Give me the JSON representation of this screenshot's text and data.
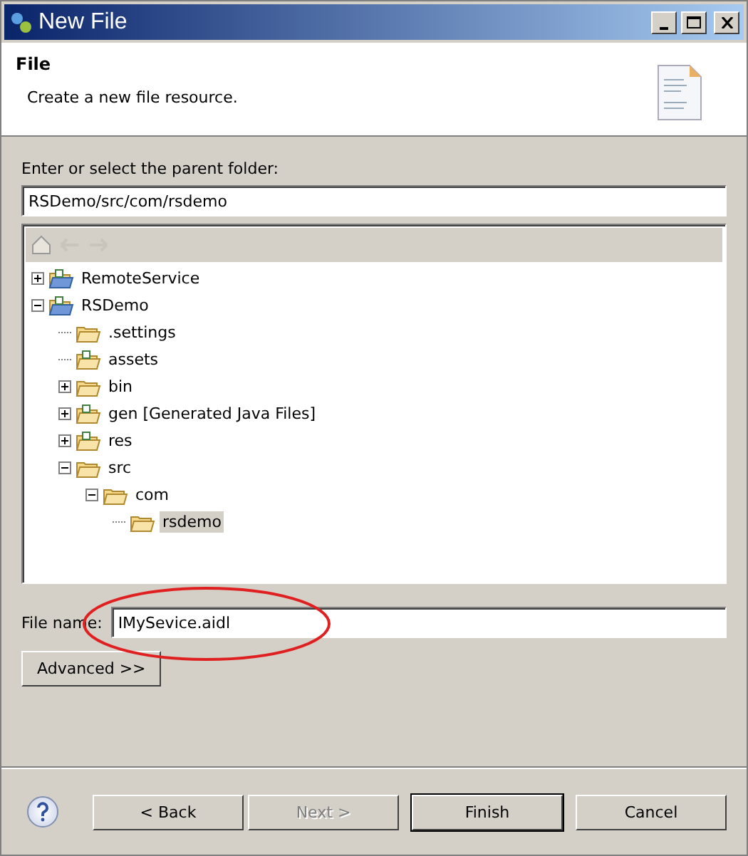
{
  "window": {
    "title": "New File"
  },
  "header": {
    "title": "File",
    "description": "Create a new file resource."
  },
  "folder_label": "Enter or select the parent folder:",
  "folder_path": "RSDemo/src/com/rsdemo",
  "tree": [
    {
      "label": "RemoteService",
      "kind": "project",
      "expanded": false,
      "selected": false
    },
    {
      "label": "RSDemo",
      "kind": "project",
      "expanded": true,
      "selected": false,
      "children": [
        {
          "label": ".settings",
          "kind": "folder",
          "selected": false
        },
        {
          "label": "assets",
          "kind": "source",
          "selected": false
        },
        {
          "label": "bin",
          "kind": "folder",
          "expanded": false,
          "selected": false
        },
        {
          "label": "gen [Generated Java Files]",
          "kind": "source",
          "expanded": false,
          "selected": false
        },
        {
          "label": "res",
          "kind": "source",
          "expanded": false,
          "selected": false
        },
        {
          "label": "src",
          "kind": "folder",
          "expanded": true,
          "selected": false,
          "children": [
            {
              "label": "com",
              "kind": "folder",
              "expanded": true,
              "selected": false,
              "children": [
                {
                  "label": "rsdemo",
                  "kind": "folder",
                  "selected": true
                }
              ]
            }
          ]
        }
      ]
    }
  ],
  "file_name_label": "File name:",
  "file_name": "IMySevice.aidl",
  "advanced_button": "Advanced >>",
  "buttons": [
    {
      "label": "< Back",
      "disabled": false,
      "default": false
    },
    {
      "label": "Next >",
      "disabled": true,
      "default": false
    },
    {
      "label": "Finish",
      "disabled": false,
      "default": true
    },
    {
      "label": "Cancel",
      "disabled": false,
      "default": false
    }
  ]
}
